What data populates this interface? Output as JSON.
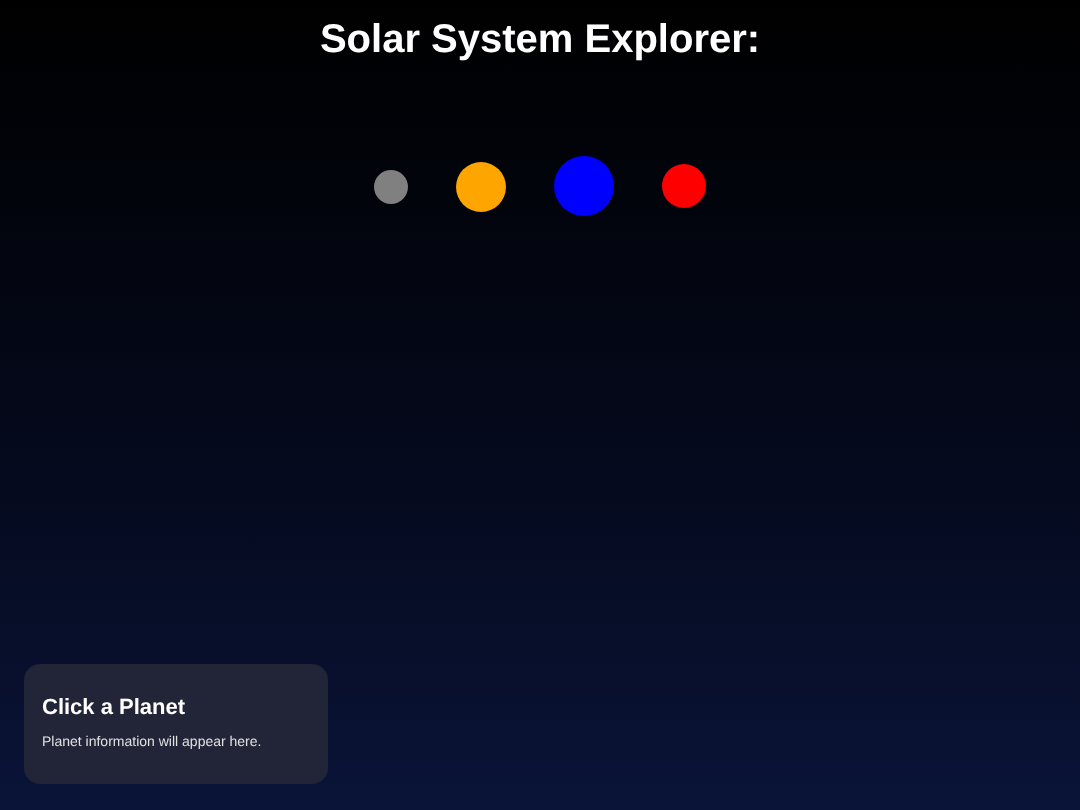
{
  "title": "Solar System Explorer:",
  "planets": [
    {
      "color": "#808080"
    },
    {
      "color": "#ffa500"
    },
    {
      "color": "#0000ff"
    },
    {
      "color": "#ff0000"
    }
  ],
  "info_panel": {
    "heading": "Click a Planet",
    "text": "Planet information will appear here."
  }
}
